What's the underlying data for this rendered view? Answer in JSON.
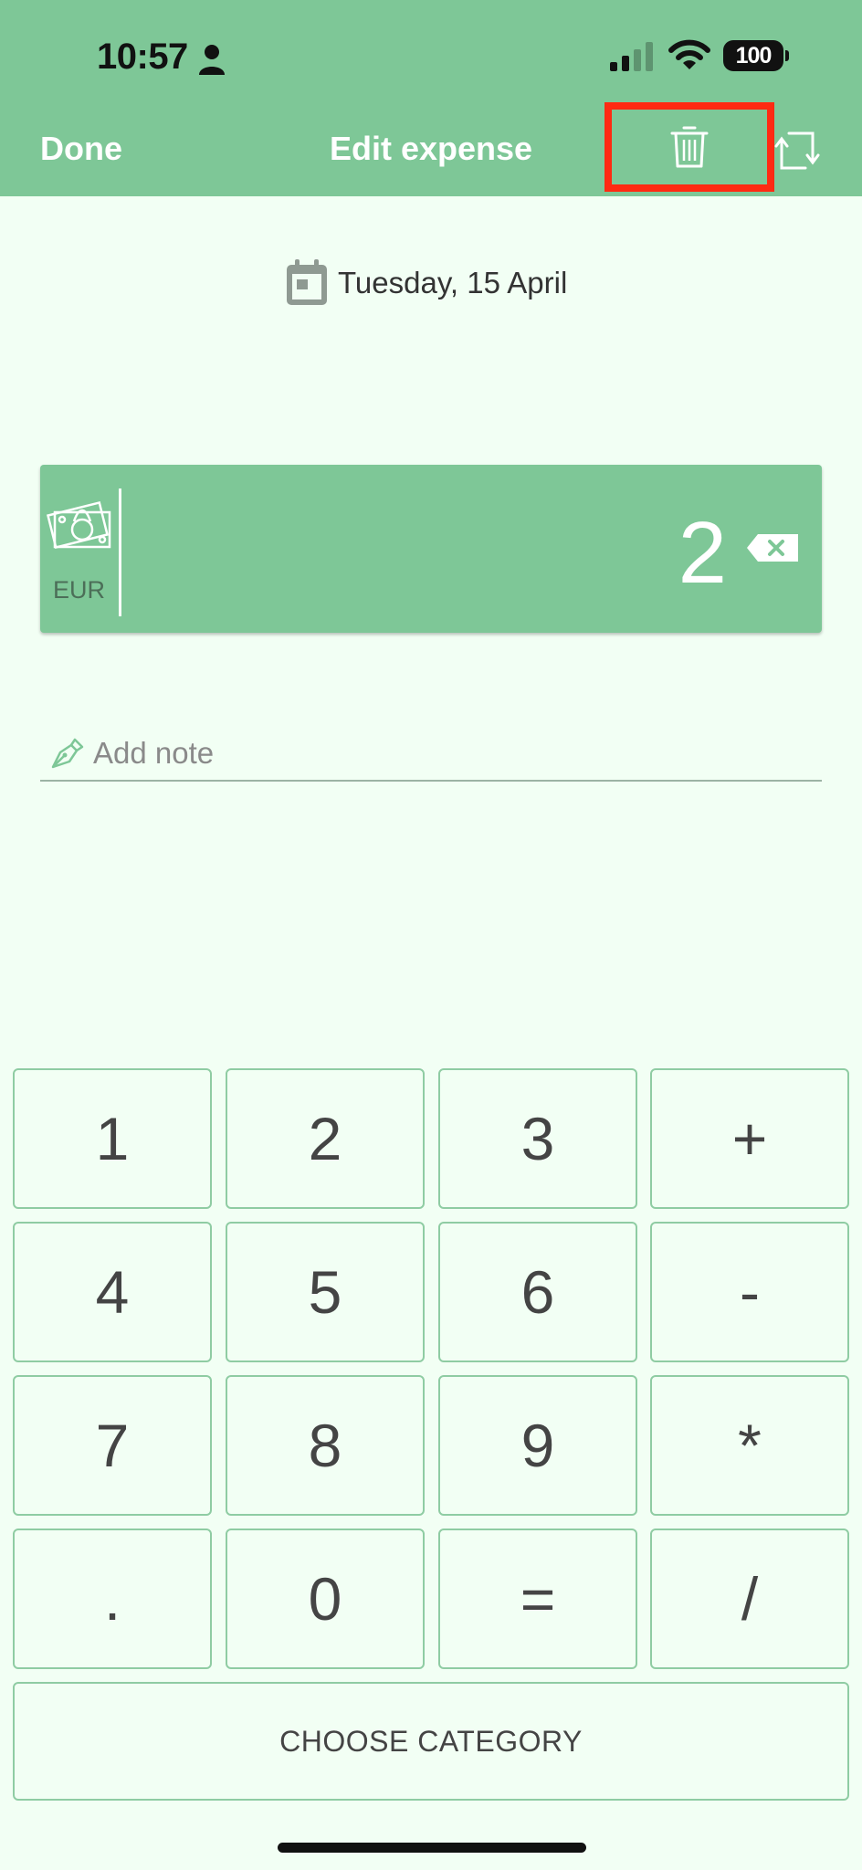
{
  "status_bar": {
    "time": "10:57",
    "battery": "100"
  },
  "nav": {
    "done_label": "Done",
    "title": "Edit expense"
  },
  "date": {
    "label": "Tuesday, 15 April"
  },
  "amount": {
    "currency": "EUR",
    "value": "2"
  },
  "note": {
    "placeholder": "Add note"
  },
  "keypad": {
    "keys": [
      "1",
      "2",
      "3",
      "+",
      "4",
      "5",
      "6",
      "-",
      "7",
      "8",
      "9",
      "*",
      ".",
      "0",
      "=",
      "/"
    ]
  },
  "category_button": {
    "label": "CHOOSE CATEGORY"
  },
  "colors": {
    "accent": "#7ec797",
    "background": "#f2fff4",
    "highlight": "#ff2a12"
  }
}
